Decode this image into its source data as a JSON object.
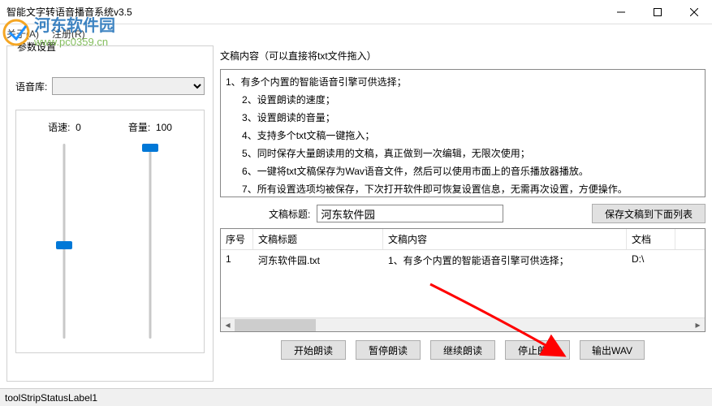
{
  "window": {
    "title": "智能文字转语音播音系统v3.5"
  },
  "menu": {
    "about": "关于(A)",
    "register": "注册(R)"
  },
  "watermark": {
    "line1": "河东软件园",
    "line2": "www.pc0359.cn"
  },
  "params": {
    "group_title": "参数设置",
    "voice_label": "语音库:",
    "speed_label": "语速:",
    "speed_value": "0",
    "volume_label": "音量:",
    "volume_value": "100",
    "speed_thumb_pct": 50,
    "volume_thumb_pct": 0
  },
  "doc": {
    "label": "文稿内容（可以直接将txt文件拖入）",
    "content": "1、有多个内置的智能语音引擎可供选择；\n      2、设置朗读的速度；\n      3、设置朗读的音量；\n      4、支持多个txt文稿一键拖入；\n      5、同时保存大量朗读用的文稿，真正做到一次编辑，无限次使用；\n      6、一键将txt文稿保存为Wav语音文件，然后可以使用市面上的音乐播放器播放。\n      7、所有设置选项均被保存，下次打开软件即可恢复设置信息，无需再次设置，方便操作。"
  },
  "title_row": {
    "label": "文稿标题:",
    "value": "河东软件园",
    "save_btn": "保存文稿到下面列表"
  },
  "list": {
    "headers": {
      "no": "序号",
      "title": "文稿标题",
      "content": "文稿内容",
      "extra": "文档"
    },
    "rows": [
      {
        "no": "1",
        "title": "河东软件园.txt",
        "content": "1、有多个内置的智能语音引擎可供选择；",
        "extra": "D:\\"
      }
    ]
  },
  "buttons": {
    "start": "开始朗读",
    "pause": "暂停朗读",
    "resume": "继续朗读",
    "stop": "停止朗读",
    "export": "输出WAV"
  },
  "status": {
    "text": "toolStripStatusLabel1"
  }
}
